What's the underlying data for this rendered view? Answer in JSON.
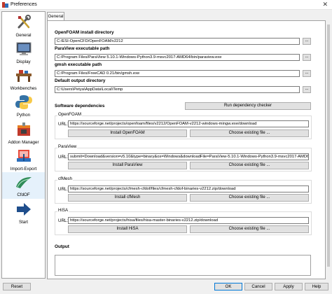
{
  "window": {
    "title": "Preferences",
    "close": "✕"
  },
  "sidebar": {
    "items": [
      {
        "label": "General",
        "icon": "wrench-screwdriver-icon"
      },
      {
        "label": "Display",
        "icon": "monitor-icon"
      },
      {
        "label": "Workbenches",
        "icon": "workbench-icon"
      },
      {
        "label": "Python",
        "icon": "python-icon"
      },
      {
        "label": "Addon Manager",
        "icon": "addon-box-icon"
      },
      {
        "label": "Import-Export",
        "icon": "import-export-icon"
      },
      {
        "label": "CfdOF",
        "icon": "cfdof-icon"
      },
      {
        "label": "Start",
        "icon": "start-arrow-icon"
      }
    ]
  },
  "tabs": [
    {
      "label": "General"
    }
  ],
  "general": {
    "openfoam_label": "OpenFOAM install directory",
    "openfoam_value": "C:/ESI-OpenCFD/OpenFOAM/v2212",
    "paraview_label": "ParaView executable path",
    "paraview_value": "C:/Program Files/ParaView 5.10.1-Windows-Python3.9-msvc2017-AMD64/bin/paraview.exe",
    "gmsh_label": "gmsh executable path",
    "gmsh_value": "C:/Program Files/FreeCAD 0.21/bin/gmsh.exe",
    "output_dir_label": "Default output directory",
    "output_dir_value": "C:\\Users\\Petya\\AppData\\Local\\Temp",
    "browse": "..."
  },
  "deps": {
    "title": "Software dependencies",
    "run_checker": "Run dependency checker",
    "url_label": "URL:",
    "choose_file": "Choose existing file ...",
    "openfoam": {
      "title": "OpenFOAM",
      "url": "https://sourceforge.net/projects/openfoam/files/v2212/OpenFOAM-v2212-windows-mingw.exe/download",
      "install": "Install OpenFOAM"
    },
    "paraview": {
      "title": "ParaView",
      "url": "submit=Download&version=v5.10&type=binary&os=Windows&downloadFile=ParaView-5.10.1-Windows-Python3.9-msvc2017-AMD64.exe",
      "install": "Install ParaView"
    },
    "cfmesh": {
      "title": "cfMesh",
      "url": "https://sourceforge.net/projects/cfmesh-cfdof/files/cfmesh-cfdof-binaries-v2212.zip/download",
      "install": "Install cfMesh"
    },
    "hisa": {
      "title": "HiSA",
      "url": "https://sourceforge.net/projects/hisa/files/hisa-master-binaries-v2212.zip/download",
      "install": "Install HiSA"
    }
  },
  "output": {
    "title": "Output"
  },
  "footer": {
    "reset": "Reset",
    "ok": "OK",
    "cancel": "Cancel",
    "apply": "Apply",
    "help": "Help"
  }
}
